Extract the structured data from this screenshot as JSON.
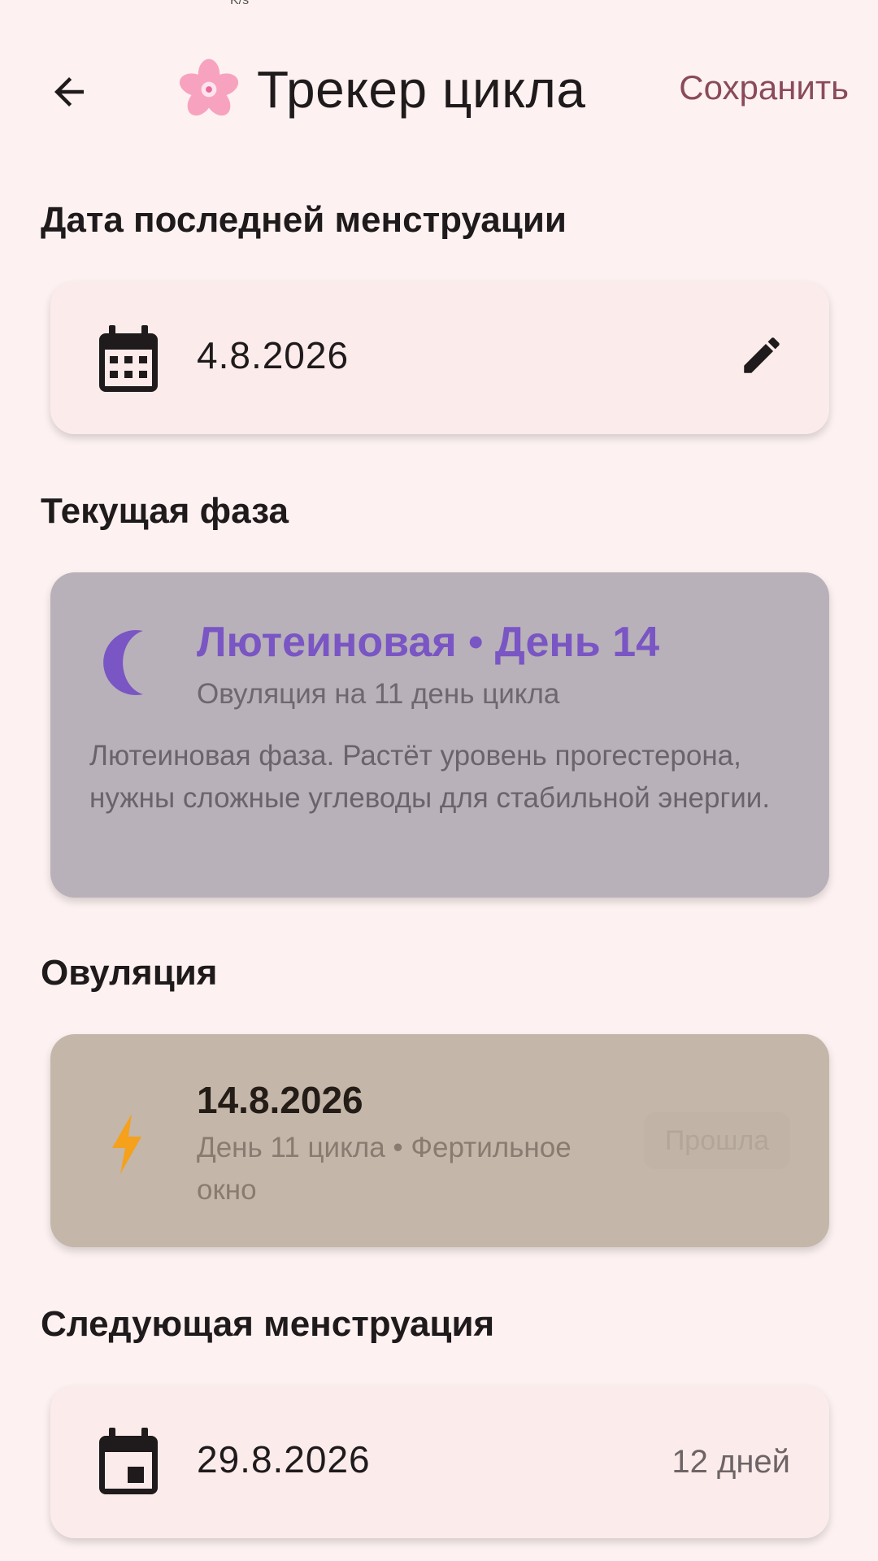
{
  "status": {
    "fragment": "K/s"
  },
  "app_bar": {
    "back_icon": "arrow-back-icon",
    "emoji_icon": "cherry-blossom-icon",
    "title": "Трекер цикла",
    "save_label": "Сохранить"
  },
  "last_period": {
    "heading": "Дата последней менструации",
    "date": "4.8.2026",
    "icon": "calendar-icon",
    "edit_icon": "pencil-icon"
  },
  "current_phase": {
    "heading": "Текущая фаза",
    "icon": "moon-icon",
    "title": "Лютеиновая • День 14",
    "subtitle": "Овуляция на 11 день цикла",
    "description": "Лютеиновая фаза. Растёт уровень прогестерона, нужны сложные углеводы для стабильной энергии.",
    "accent_color": "#7a55c4"
  },
  "ovulation": {
    "heading": "Овуляция",
    "icon": "lightning-icon",
    "date": "14.8.2026",
    "subtitle": "День 11 цикла • Фертильное окно",
    "badge": "Прошла",
    "accent_color": "#f5a11c"
  },
  "next_period": {
    "heading": "Следующая менструация",
    "icon": "calendar-event-icon",
    "date": "29.8.2026",
    "days_left": "12 дней"
  }
}
